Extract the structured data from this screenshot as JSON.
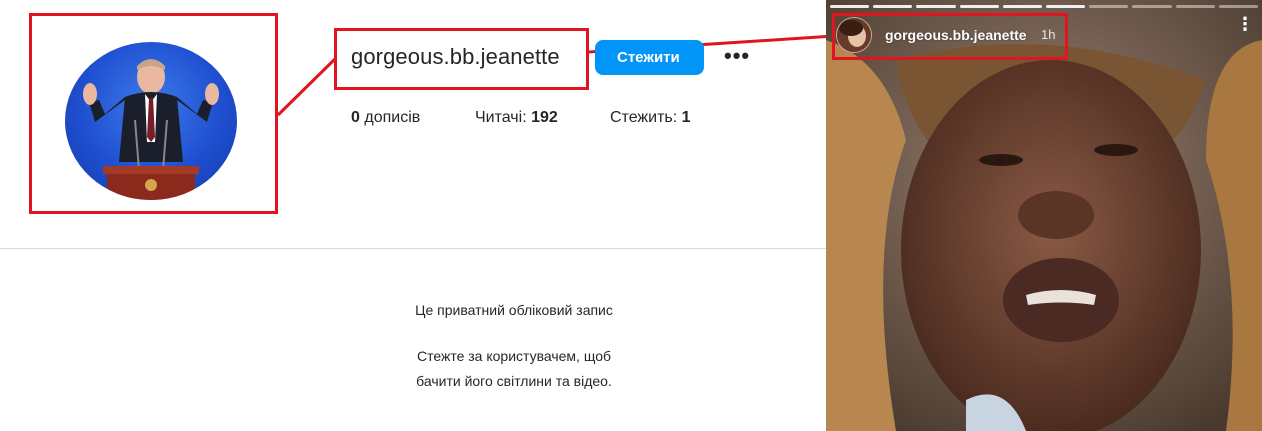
{
  "profile": {
    "username": "gorgeous.bb.jeanette",
    "follow_label": "Стежити",
    "more_icon": "more-horizontal-icon",
    "more_glyph": "•••",
    "stats": {
      "posts_count": "0",
      "posts_label": " дописів",
      "followers_label": "Читачі: ",
      "followers_count": "192",
      "following_label": "Стежить: ",
      "following_count": "1"
    },
    "private": {
      "title": "Це приватний обліковий запис",
      "desc_line1": "Стежте за користувачем, щоб",
      "desc_line2": "бачити його світлини та відео."
    }
  },
  "story": {
    "username": "gorgeous.bb.jeanette",
    "time": "1h",
    "menu_icon": "more-vertical-icon",
    "menu_glyph": "⋮"
  },
  "colors": {
    "highlight": "#e0151f",
    "follow_button": "#0095f6",
    "divider": "#dbdbdb"
  }
}
